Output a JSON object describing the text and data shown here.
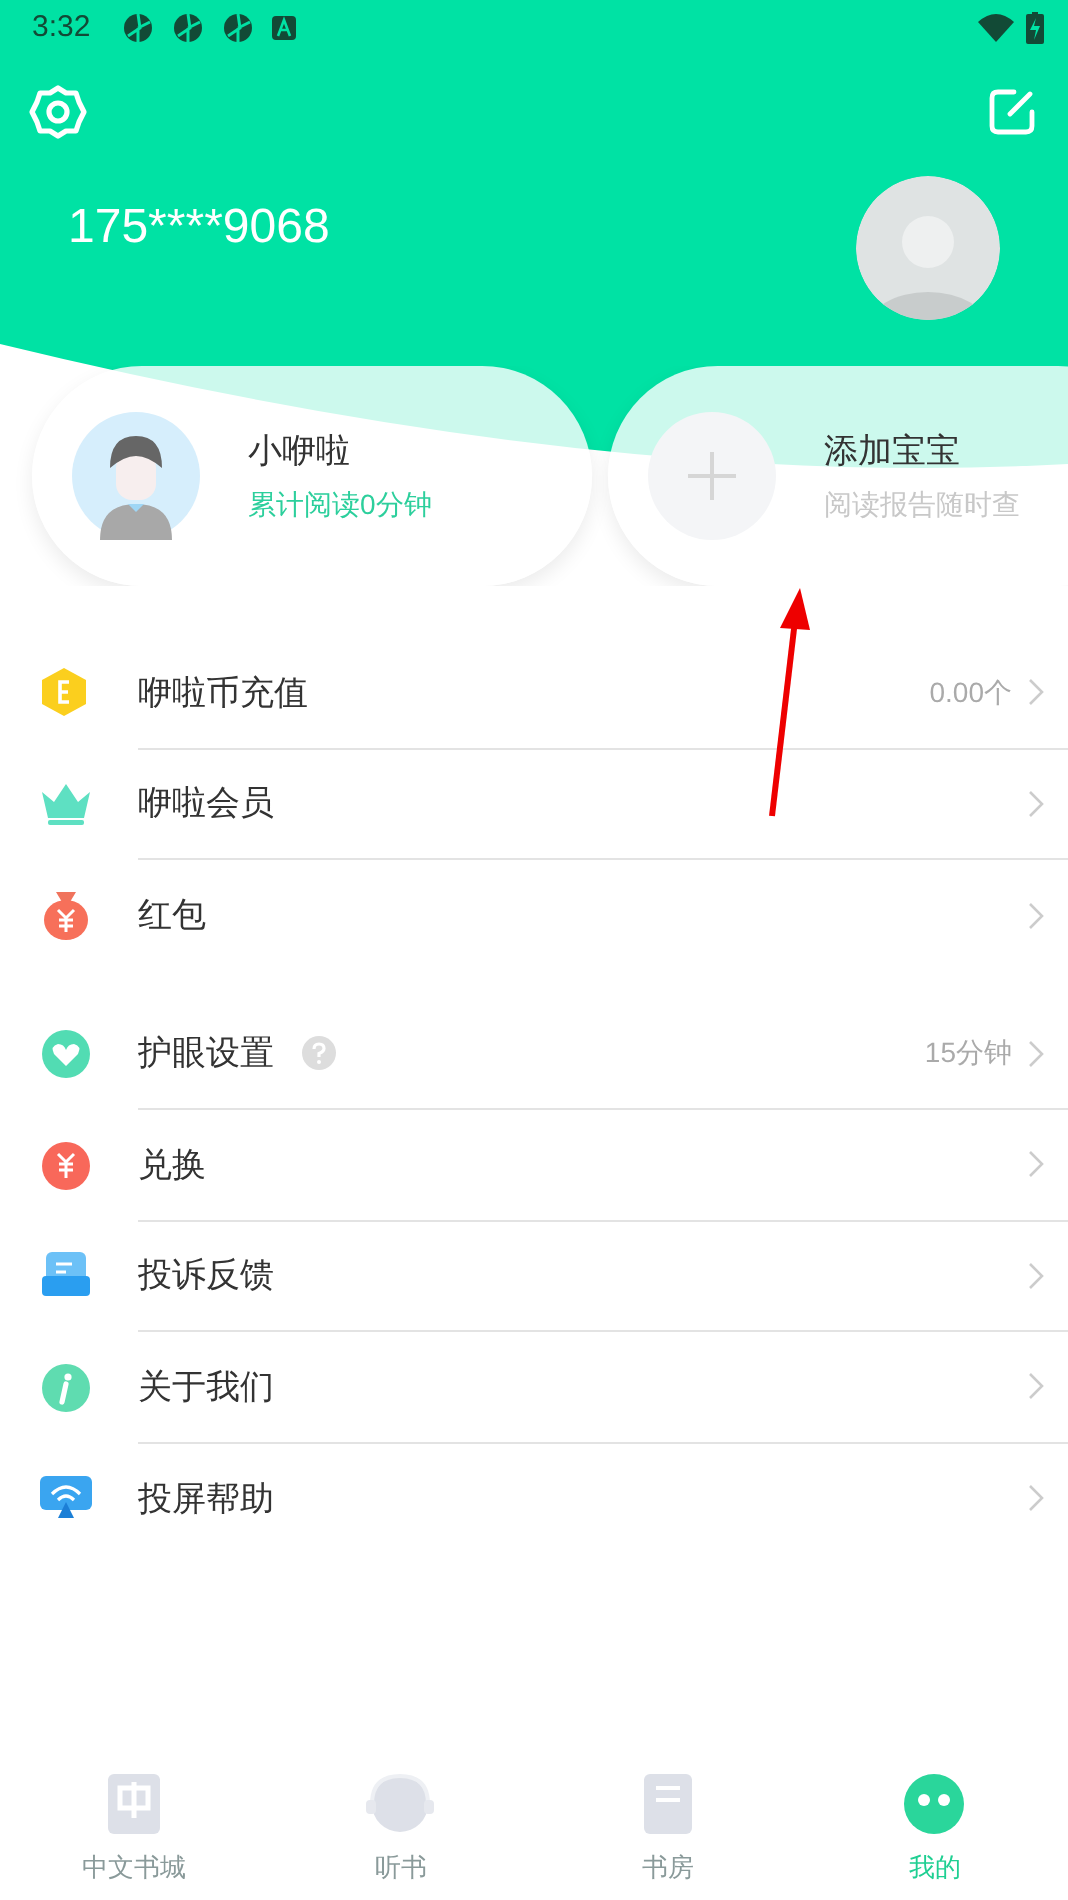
{
  "status_bar": {
    "time": "3:32"
  },
  "profile": {
    "phone": "175****9068"
  },
  "child_card": {
    "name": "小咿啦",
    "reading": "累计阅读0分钟"
  },
  "add_card": {
    "title": "添加宝宝",
    "subtitle": "阅读报告随时查"
  },
  "menu_groups": [
    [
      {
        "kind": "coin",
        "label": "咿啦币充值",
        "value": "0.00个",
        "help": false
      },
      {
        "kind": "crown",
        "label": "咿啦会员",
        "help": false
      },
      {
        "kind": "redpacket",
        "label": "红包",
        "help": false
      }
    ],
    [
      {
        "kind": "heart",
        "label": "护眼设置",
        "value": "15分钟",
        "help": true
      },
      {
        "kind": "exchange",
        "label": "兑换",
        "help": false
      },
      {
        "kind": "feedback",
        "label": "投诉反馈",
        "help": false
      },
      {
        "kind": "info",
        "label": "关于我们",
        "help": false
      },
      {
        "kind": "cast",
        "label": "投屏帮助",
        "help": false
      }
    ]
  ],
  "tab_bar": [
    {
      "kind": "book",
      "label": "中文书城",
      "selected": false
    },
    {
      "kind": "headphones",
      "label": "听书",
      "selected": false
    },
    {
      "kind": "shelf",
      "label": "书房",
      "selected": false
    },
    {
      "kind": "me",
      "label": "我的",
      "selected": true
    }
  ]
}
